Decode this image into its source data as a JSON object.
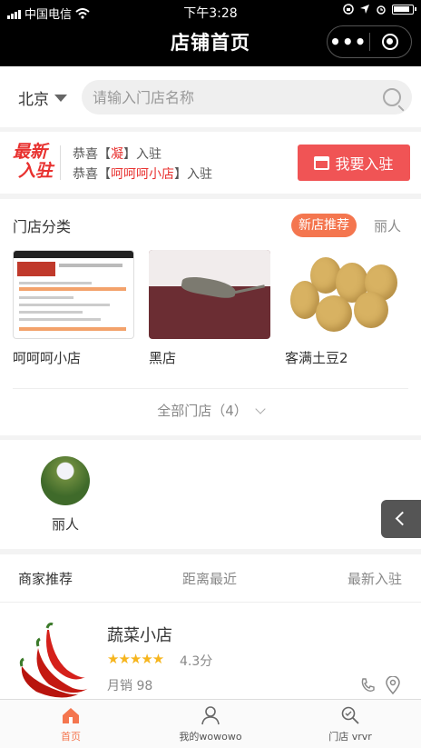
{
  "status": {
    "carrier": "中国电信",
    "time": "下午3:28"
  },
  "nav": {
    "title": "店铺首页",
    "more": "•••"
  },
  "search": {
    "city": "北京",
    "placeholder": "请输入门店名称"
  },
  "join": {
    "logo_top": "最新",
    "logo_bottom": "入驻",
    "line1_prefix": "恭喜【",
    "line1_name": "凝",
    "line1_suffix": "】入驻",
    "line2_prefix": "恭喜【",
    "line2_name": "呵呵呵小店",
    "line2_suffix": "】入驻",
    "button": "我要入驻"
  },
  "categories": {
    "title": "门店分类",
    "pill_active": "新店推荐",
    "pill_other": "丽人",
    "stores": [
      {
        "name": "呵呵呵小店"
      },
      {
        "name": "黑店"
      },
      {
        "name": "客满土豆2"
      }
    ],
    "all_label": "全部门店（4）"
  },
  "featured": {
    "name": "丽人"
  },
  "merchant_tabs": [
    "商家推荐",
    "距离最近",
    "最新入驻"
  ],
  "merchant": {
    "name": "蔬菜小店",
    "stars": "★★★★★",
    "rating": 4.3,
    "rating_label": "4.3分",
    "sales": "月销 98"
  },
  "tabbar": [
    {
      "label": "首页",
      "icon": "home-icon",
      "active": true
    },
    {
      "label": "我的wowowo",
      "icon": "person-icon",
      "active": false
    },
    {
      "label": "门店 vrvr",
      "icon": "store-search-icon",
      "active": false
    }
  ],
  "colors": {
    "accent": "#f4764f",
    "join_red": "#f05455",
    "star": "#f6b51d"
  }
}
